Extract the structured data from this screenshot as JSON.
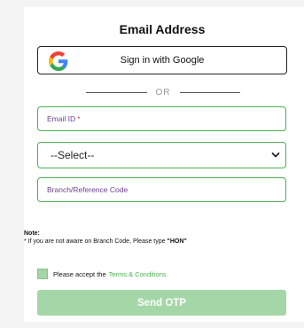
{
  "form": {
    "title": "Email Address",
    "google_button_label": "Sign in with Google",
    "divider_text": "OR",
    "email_placeholder": "Email ID",
    "required_mark": "*",
    "select_value": "--Select--",
    "branch_placeholder": "Branch/Reference Code",
    "note_title": "Note:",
    "note_text_prefix": "* If you are not aware on Branch Code, Please type ",
    "note_code": "\"HON\"",
    "consent_text": "Please accept the",
    "consent_link": "Terms & Conditions",
    "send_button_label": "Send OTP"
  },
  "colors": {
    "accent_green": "#4caf50",
    "button_disabled_green": "#a5d6a7",
    "placeholder_purple": "#6b3f8f",
    "required_red": "#e53935"
  },
  "icons": {
    "google": "google-g-icon",
    "select_arrow": "chevron-down-icon"
  }
}
